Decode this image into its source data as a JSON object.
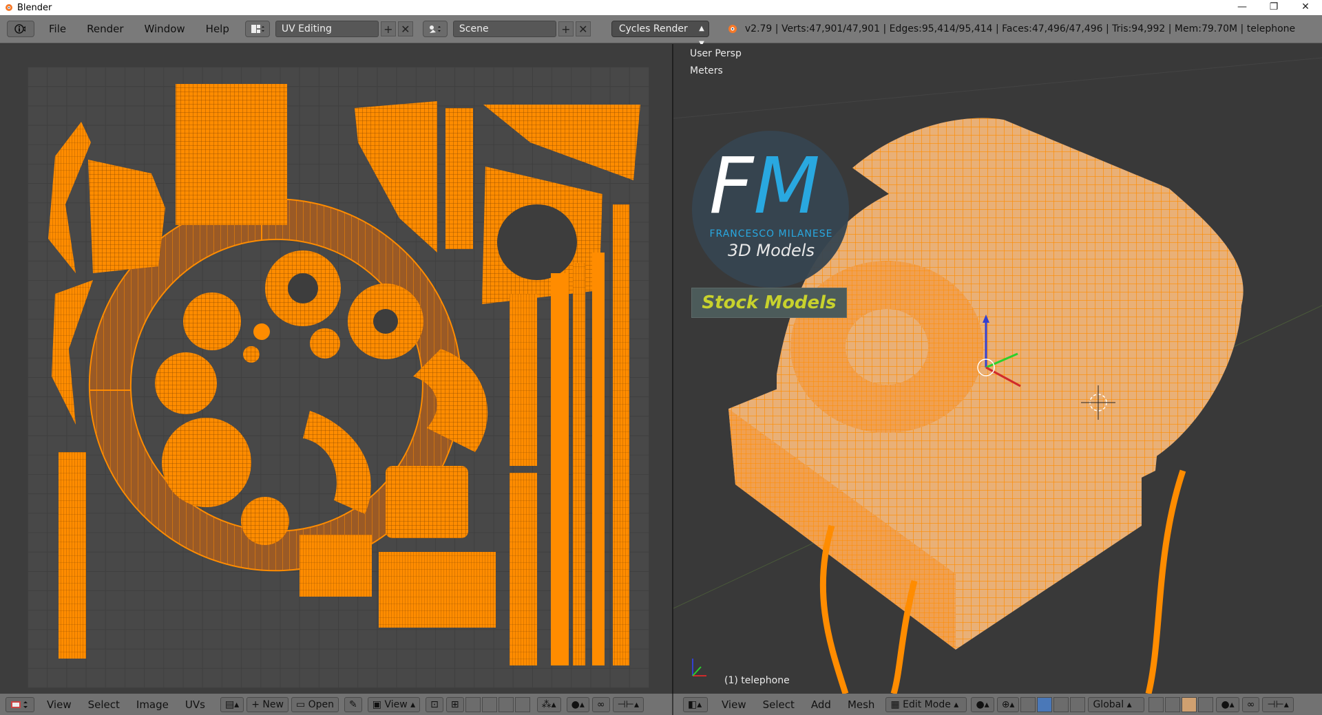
{
  "window": {
    "title": "Blender"
  },
  "menubar": {
    "items": [
      "File",
      "Render",
      "Window",
      "Help"
    ],
    "screen_layout": "UV Editing",
    "scene": "Scene",
    "render_engine": "Cycles Render",
    "stats": "v2.79 | Verts:47,901/47,901 | Edges:95,414/95,414 | Faces:47,496/47,496 | Tris:94,992 | Mem:79.70M | telephone"
  },
  "viewport": {
    "view_name": "User Persp",
    "units": "Meters",
    "object_label": "(1) telephone"
  },
  "logo": {
    "letter_f": "F",
    "letter_m": "M",
    "name": "FRANCESCO MILANESE",
    "tagline": "3D Models",
    "badge": "Stock Models"
  },
  "uv_footer": {
    "menus": [
      "View",
      "Select",
      "Image",
      "UVs"
    ],
    "new_label": "New",
    "open_label": "Open",
    "view_label": "View"
  },
  "view3d_footer": {
    "menus": [
      "View",
      "Select",
      "Add",
      "Mesh"
    ],
    "mode": "Edit Mode",
    "orientation": "Global"
  },
  "colors": {
    "mesh": "#ff8c00",
    "background": "#393939"
  }
}
